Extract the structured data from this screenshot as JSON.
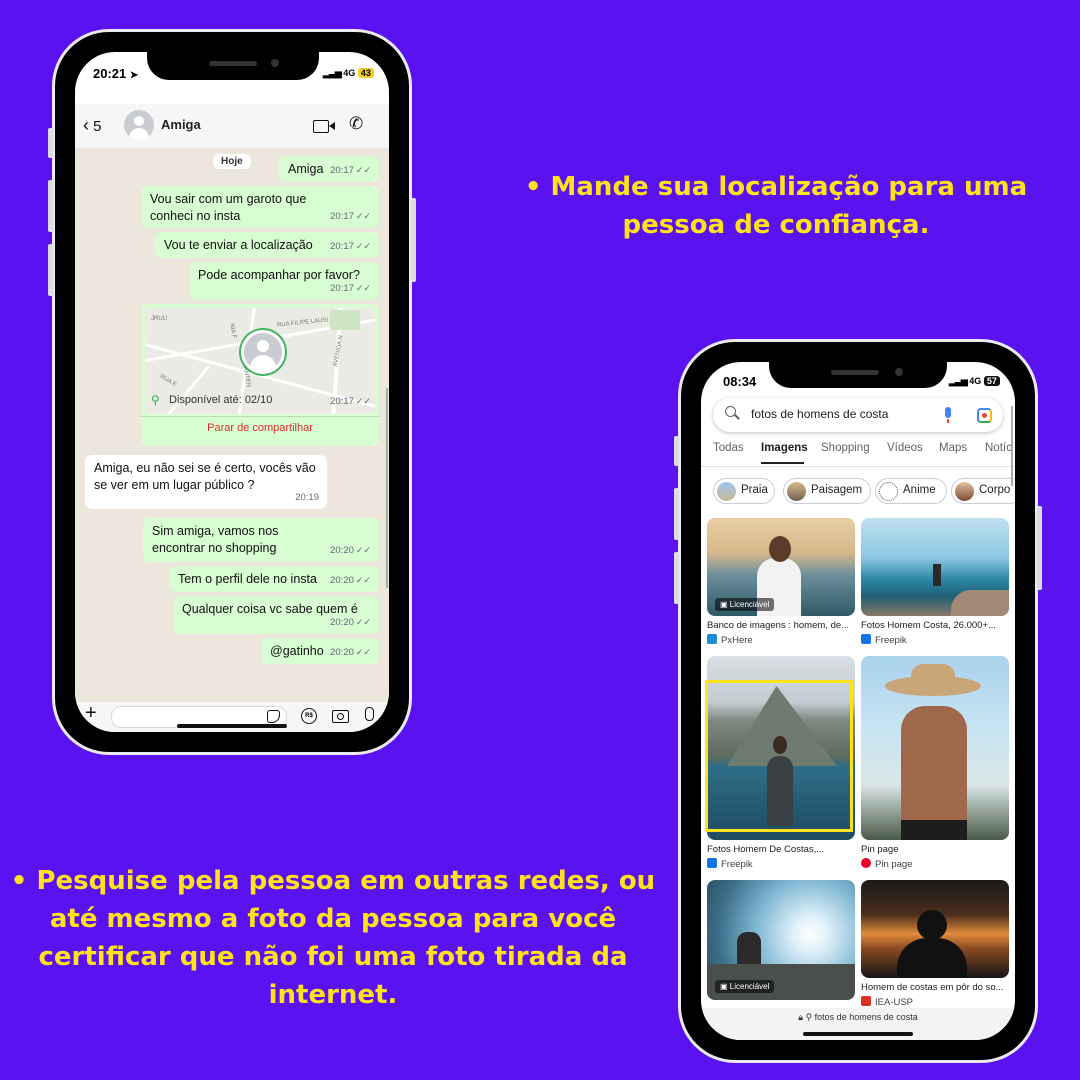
{
  "captions": {
    "top": "• Mande sua localização para uma pessoa de confiança.",
    "bottom": "• Pesquise pela pessoa em outras redes, ou até mesmo a foto da pessoa para você certificar que não foi uma foto tirada da internet."
  },
  "whatsapp": {
    "status": {
      "time": "20:21",
      "network": "4G",
      "battery": "43"
    },
    "header": {
      "back_count": "5",
      "contact": "Amiga"
    },
    "day_chip": "Hoje",
    "messages": [
      {
        "text": "Amiga",
        "time": "20:17"
      },
      {
        "text": "Vou sair com um garoto que conheci no insta",
        "time": "20:17"
      },
      {
        "text": "Vou te enviar a localização",
        "time": "20:17"
      },
      {
        "text": "Pode acompanhar por favor?",
        "time": "20:17"
      },
      {
        "text": "Amiga, eu não sei se é certo, vocês vão se ver em um lugar público ?",
        "time": "20:19"
      },
      {
        "text": "Sim amiga, vamos nos encontrar no shopping",
        "time": "20:20"
      },
      {
        "text": "Tem o perfil dele no insta",
        "time": "20:20"
      },
      {
        "text": "Qualquer coisa vc sabe quem é",
        "time": "20:20"
      },
      {
        "text": "@gatinho",
        "time": "20:20"
      }
    ],
    "location": {
      "available_until": "Disponível até: 02/10",
      "time": "20:17",
      "stop_sharing": "Parar de compartilhar",
      "map_labels": [
        "RUA FILIPE LAUSI",
        "AVENIDA N",
        "NIA F",
        "RUA E",
        "JRUU",
        "20 SANTEN"
      ]
    }
  },
  "google": {
    "status": {
      "time": "08:34",
      "network": "4G",
      "battery": "57"
    },
    "search_query": "fotos de homens de costa",
    "tabs": [
      "Todas",
      "Imagens",
      "Shopping",
      "Vídeos",
      "Maps",
      "Notíc"
    ],
    "active_tab": "Imagens",
    "chips": [
      "Praia",
      "Paisagem",
      "Anime",
      "Corpo"
    ],
    "badge": "Licenciável",
    "results": [
      {
        "title": "Banco de imagens : homem, de...",
        "source": "PxHere"
      },
      {
        "title": "Fotos Homem Costa, 26.000+...",
        "source": "Freepik"
      },
      {
        "title": "Fotos Homem De Costas,...",
        "source": "Freepik"
      },
      {
        "title": "Pin page",
        "source": "Pin page"
      },
      {
        "title": "",
        "source": ""
      },
      {
        "title": "Homem de costas em pôr do so...",
        "source": "IEA-USP"
      }
    ],
    "url_bar": "fotos de homens de costa",
    "colors": {
      "highlight": "#ffe21c",
      "active_tab": "#202124"
    }
  }
}
